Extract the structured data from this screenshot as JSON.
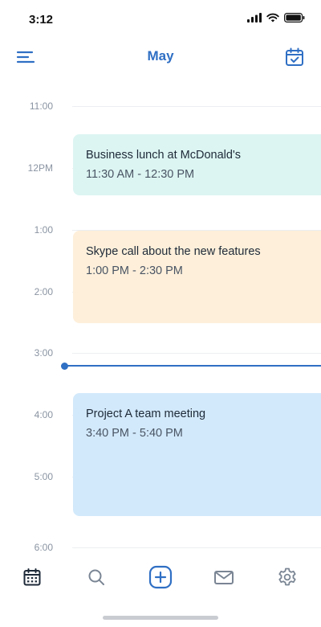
{
  "status_bar": {
    "time": "3:12"
  },
  "header": {
    "title": "May"
  },
  "timeline": {
    "hours": [
      "11:00",
      "12PM",
      "1:00",
      "2:00",
      "3:00",
      "4:00",
      "5:00",
      "6:00"
    ]
  },
  "events": [
    {
      "title": "Business lunch at McDonald's",
      "time": "11:30 AM - 12:30 PM",
      "color": "#dcf5f2"
    },
    {
      "title": "Skype call about the new features",
      "time": "1:00 PM - 2:30 PM",
      "color": "#fdefda"
    },
    {
      "title": "Project A team meeting",
      "time": "3:40 PM - 5:40 PM",
      "color": "#d2e9fb"
    }
  ],
  "accent_color": "#2f6fc4",
  "tab_bar": {
    "items": [
      {
        "icon": "calendar-icon",
        "active": true
      },
      {
        "icon": "search-icon",
        "active": false
      },
      {
        "icon": "add-icon",
        "active": false
      },
      {
        "icon": "mail-icon",
        "active": false
      },
      {
        "icon": "settings-icon",
        "active": false
      }
    ]
  }
}
